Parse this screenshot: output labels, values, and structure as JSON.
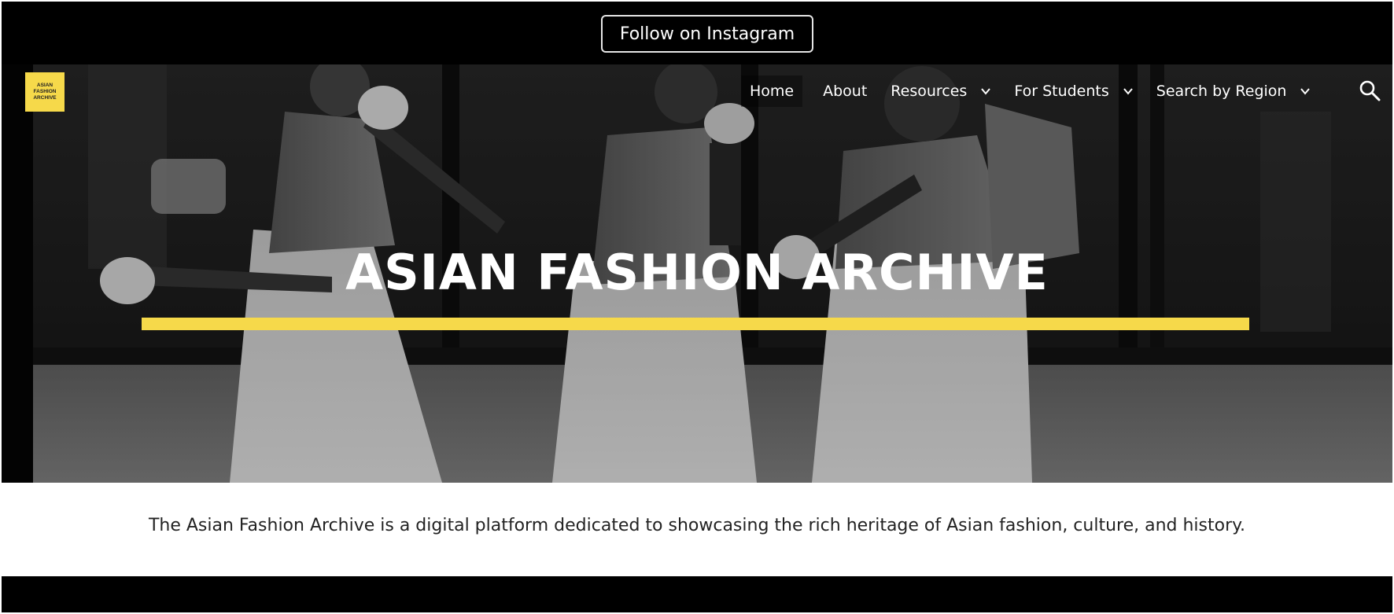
{
  "announcement": {
    "button_label": "Follow on Instagram"
  },
  "brand": {
    "logo_line1": "ASIAN",
    "logo_line2": "FASHION",
    "logo_line3": "ARCHIVE",
    "logo_color": "#f6d94a"
  },
  "nav": {
    "items": [
      {
        "label": "Home",
        "active": true
      },
      {
        "label": "About"
      },
      {
        "label": "Resources",
        "dropdown": true
      },
      {
        "label": "For Students",
        "dropdown": true
      },
      {
        "label": "Search by Region",
        "dropdown": true
      }
    ],
    "search_icon": "search-icon"
  },
  "hero": {
    "title": "ASIAN FASHION ARCHIVE",
    "accent_color": "#f6d94a"
  },
  "tagline": "The Asian Fashion Archive is a digital platform dedicated to showcasing the rich heritage of Asian fashion, culture, and history."
}
